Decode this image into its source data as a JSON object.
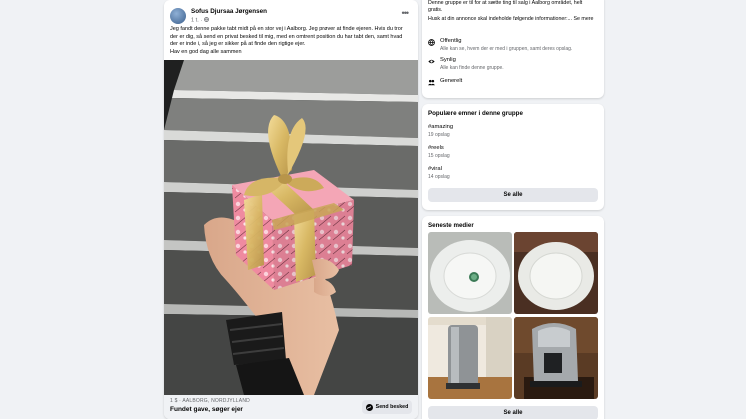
{
  "post": {
    "author": "Sofus Djursaa Jørgensen",
    "time": "1 t.",
    "text_lines": [
      "Jeg fandt denne pakke tabt midt på en stor vej i Aalborg. Jeg prøver at finde ejeren. Hvis du tror",
      "der er dig, så send en privat besked til mig, med en omtrent position du har tabt den, samt hvad",
      "der er inde i, så jeg er sikker på at finde den rigtige ejer.",
      "Hav en god dag alle sammen"
    ],
    "listing": {
      "location": "1 $ · AALBORG, NORDJYLLAND",
      "title": "Fundet gave, søger ejer",
      "send_label": "Send besked"
    }
  },
  "about": {
    "description": "Denne gruppe er til for at sætte ting til salg i Aalborg området, helt gratis.",
    "note": "Husk at din annonce skal indeholde følgende informationer:... Se mere",
    "items": [
      {
        "title": "Offentlig",
        "subtitle": "Alle kan se, hvem der er med i gruppen, samt deres opslag."
      },
      {
        "title": "Synlig",
        "subtitle": "Alle kan finde denne gruppe."
      },
      {
        "title": "Generelt",
        "subtitle": ""
      }
    ]
  },
  "topics": {
    "title": "Populære emner i denne gruppe",
    "items": [
      {
        "tag": "#amazing",
        "count": "19 opslag"
      },
      {
        "tag": "#reels",
        "count": "15 opslag"
      },
      {
        "tag": "#viral",
        "count": "14 opslag"
      }
    ],
    "see_all": "Se alle"
  },
  "media": {
    "title": "Seneste medier",
    "see_all": "Se alle"
  },
  "colors": {
    "background": "#f0f2f5",
    "card": "#ffffff",
    "button": "#e4e6eb",
    "secondary_text": "#65676b"
  }
}
